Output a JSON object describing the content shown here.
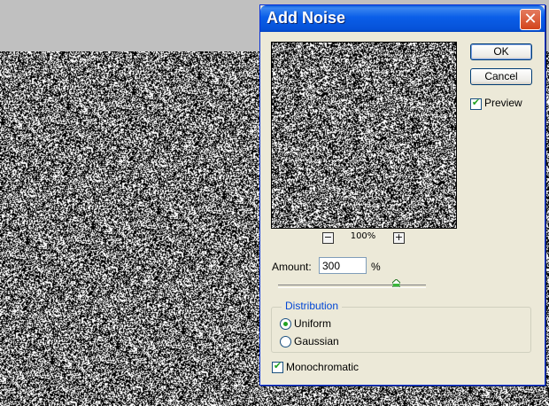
{
  "dialog": {
    "title": "Add Noise",
    "close_glyph": "✕",
    "buttons": {
      "ok_label": "OK",
      "cancel_label": "Cancel"
    },
    "preview": {
      "label": "Preview",
      "checked": true,
      "zoom_level": "100%",
      "zoom_out_glyph": "−",
      "zoom_in_glyph": "+"
    },
    "amount": {
      "label": "Amount:",
      "value": "300",
      "unit": "%",
      "slider_fraction": 0.8
    },
    "distribution": {
      "legend": "Distribution",
      "options": [
        {
          "label": "Uniform",
          "selected": true
        },
        {
          "label": "Gaussian",
          "selected": false
        }
      ]
    },
    "monochromatic": {
      "label": "Monochromatic",
      "checked": true
    }
  },
  "colors": {
    "title_bar": "#0a5ee8",
    "close_button": "#d3441b",
    "dialog_bg": "#ece9d8",
    "group_legend": "#0046d5",
    "check_tick": "#21a121",
    "canvas_bg": "#c0c0c0"
  },
  "icons": {
    "close": "close-icon",
    "zoom_out": "minus-icon",
    "zoom_in": "plus-icon",
    "check": "checkmark-icon",
    "slider": "slider-thumb-icon"
  }
}
